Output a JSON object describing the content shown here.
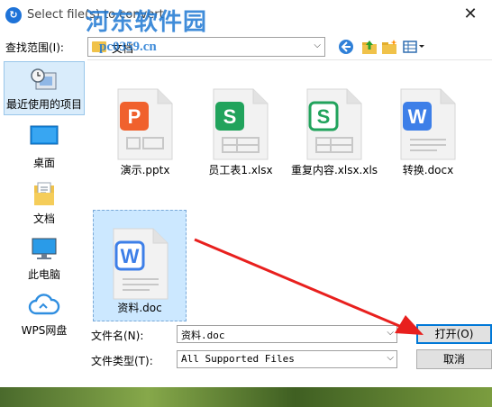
{
  "window": {
    "title": "Select file(s) to convert",
    "close_glyph": "✕"
  },
  "watermark": {
    "line1": "河东软件园",
    "line2": "pc0359.cn"
  },
  "location": {
    "label": "查找范围(I):",
    "value": "文档"
  },
  "sidebar": {
    "items": [
      {
        "label": "最近使用的项目",
        "icon": "recent-items-icon"
      },
      {
        "label": "桌面",
        "icon": "desktop-icon"
      },
      {
        "label": "文档",
        "icon": "documents-icon"
      },
      {
        "label": "此电脑",
        "icon": "this-pc-icon"
      },
      {
        "label": "WPS网盘",
        "icon": "wps-cloud-icon"
      }
    ]
  },
  "files": [
    {
      "name": "演示.pptx",
      "app": "P",
      "color": "#f0612d"
    },
    {
      "name": "员工表1.xlsx",
      "app": "S",
      "color": "#21a35c"
    },
    {
      "name": "重复内容.xlsx.xls",
      "app": "S",
      "color": "#21a35c"
    },
    {
      "name": "转换.docx",
      "app": "W",
      "color": "#3d7fe8"
    },
    {
      "name": "资料.doc",
      "app": "W",
      "color": "#3d7fe8",
      "selected": true
    }
  ],
  "filename": {
    "label": "文件名(N):",
    "value": "资料.doc"
  },
  "filetype": {
    "label": "文件类型(T):",
    "value": "All Supported Files"
  },
  "buttons": {
    "open": "打开(O)",
    "cancel": "取消"
  },
  "colors": {
    "accent": "#0078d7",
    "selection": "#cce8ff",
    "annotation_arrow": "#e8201e"
  }
}
